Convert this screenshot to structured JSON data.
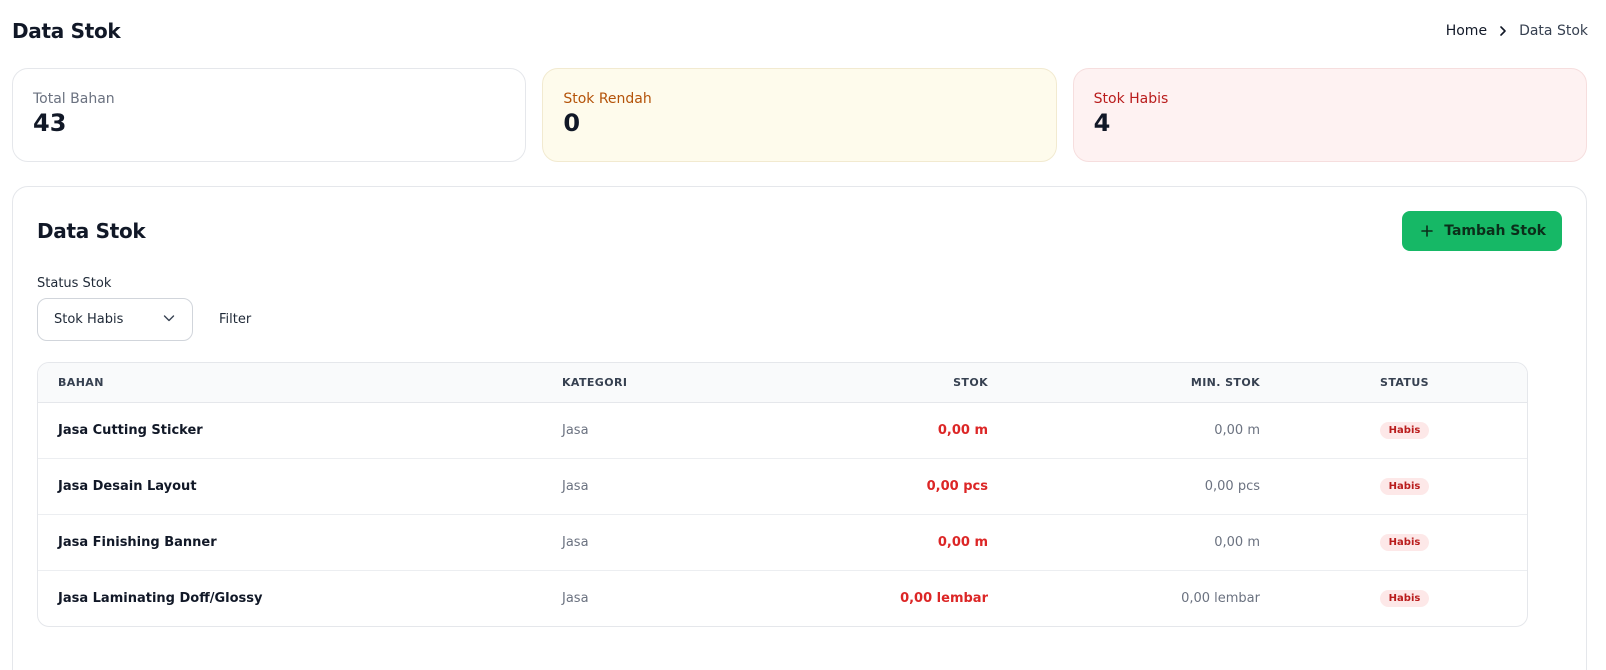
{
  "header": {
    "title": "Data Stok",
    "breadcrumb": {
      "home": "Home",
      "current": "Data Stok"
    }
  },
  "stats": [
    {
      "label": "Total Bahan",
      "value": "43"
    },
    {
      "label": "Stok Rendah",
      "value": "0"
    },
    {
      "label": "Stok Habis",
      "value": "4"
    }
  ],
  "main": {
    "title": "Data Stok",
    "add_button": "Tambah Stok",
    "filter": {
      "label": "Status Stok",
      "selected": "Stok Habis",
      "button": "Filter"
    },
    "table": {
      "columns": [
        "BAHAN",
        "KATEGORI",
        "STOK",
        "MIN. STOK",
        "STATUS"
      ],
      "rows": [
        {
          "bahan": "Jasa Cutting Sticker",
          "kategori": "Jasa",
          "stok": "0,00 m",
          "min_stok": "0,00 m",
          "status": "Habis"
        },
        {
          "bahan": "Jasa Desain Layout",
          "kategori": "Jasa",
          "stok": "0,00 pcs",
          "min_stok": "0,00 pcs",
          "status": "Habis"
        },
        {
          "bahan": "Jasa Finishing Banner",
          "kategori": "Jasa",
          "stok": "0,00 m",
          "min_stok": "0,00 m",
          "status": "Habis"
        },
        {
          "bahan": "Jasa Laminating Doff/Glossy",
          "kategori": "Jasa",
          "stok": "0,00 lembar",
          "min_stok": "0,00 lembar",
          "status": "Habis"
        }
      ]
    }
  },
  "colors": {
    "accent_green": "#16b866",
    "danger_red": "#dc2626",
    "warning_amber": "#b45309"
  }
}
